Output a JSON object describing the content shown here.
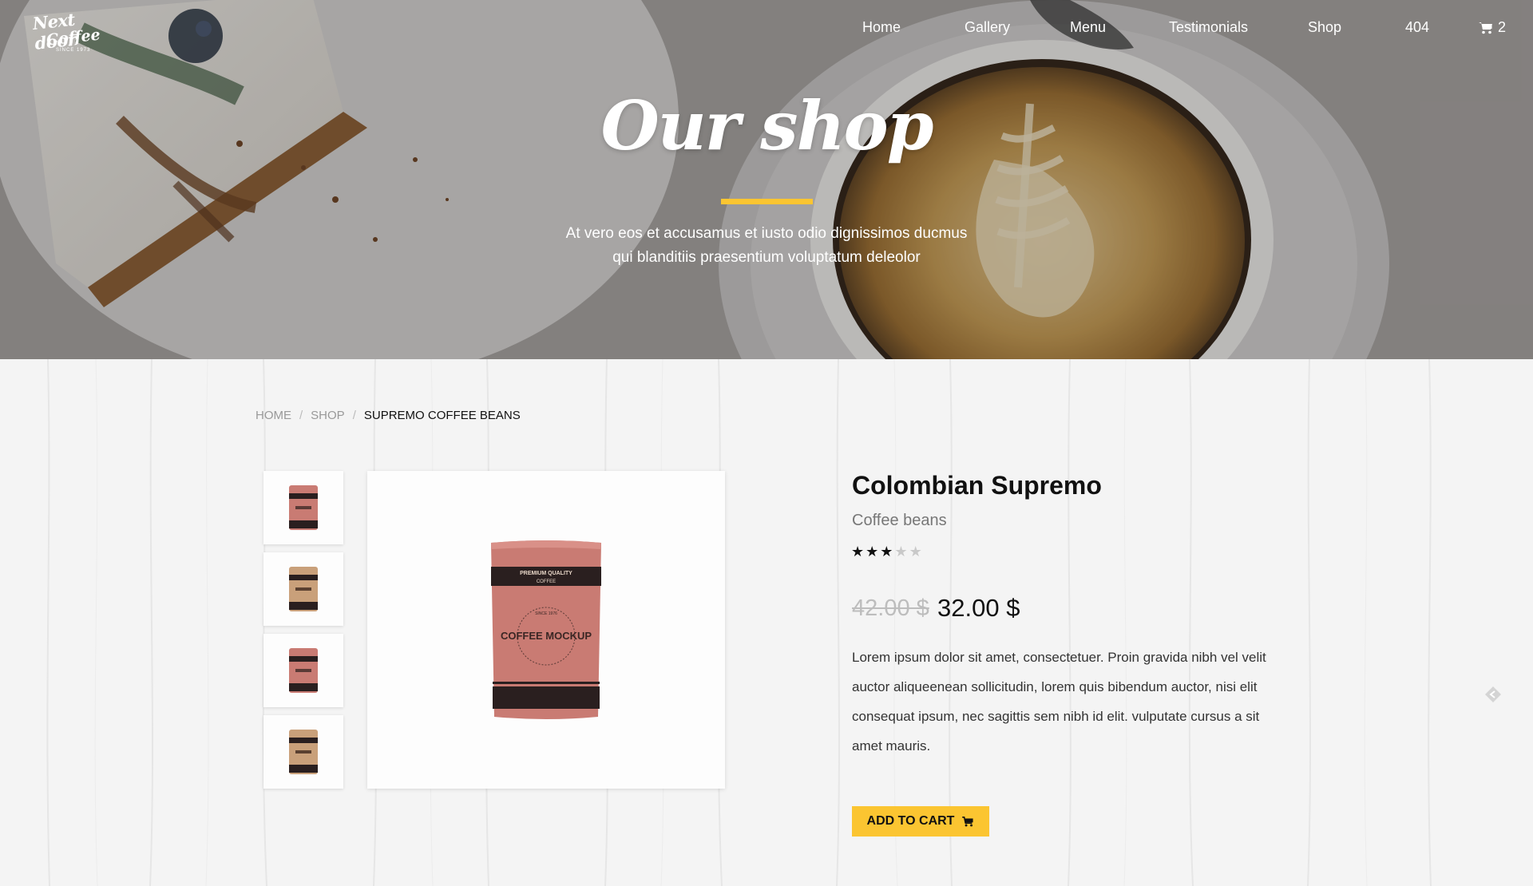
{
  "brand": {
    "logo_line1": "Next door",
    "logo_line2": "Coffee",
    "logo_since": "SINCE 1973"
  },
  "nav": {
    "items": [
      "Home",
      "Gallery",
      "Menu",
      "Testimonials",
      "Shop",
      "404"
    ],
    "cart_count": "2",
    "cart_icon": "cart-icon"
  },
  "hero": {
    "title": "Our shop",
    "subtitle_line1": "At vero eos et accusamus et iusto odio dignissimos ducmus",
    "subtitle_line2": "qui blanditiis praesentium voluptatum deleolor"
  },
  "breadcrumb": {
    "items": [
      "HOME",
      "SHOP",
      "SUPREMO COFFEE BEANS"
    ],
    "separator": "/"
  },
  "product": {
    "title": "Colombian Supremo",
    "subtitle": "Coffee beans",
    "rating": 3,
    "rating_max": 5,
    "price_old": "42.00 $",
    "price_new": "32.00 $",
    "description": "Lorem ipsum dolor sit amet, consectetuer. Proin gravida nibh vel velit auctor aliqueenean sollicitudin, lorem quis bibendum auctor, nisi elit consequat ipsum, nec sagittis sem nibh id elit. vulputate cursus a sit amet mauris.",
    "add_to_cart": "ADD TO CART",
    "bag_label_top": "PREMIUM QUALITY",
    "bag_label_top2": "COFFEE",
    "bag_label_main": "COFFEE MOCKUP",
    "bag_label_since": "SINCE 1976",
    "thumbnails": [
      "pink",
      "kraft",
      "pink",
      "kraft"
    ]
  },
  "colors": {
    "accent": "#fbc531",
    "bag_pink": "#c97b73",
    "bag_kraft": "#c9a07a",
    "bag_dark": "#2a1f1f"
  }
}
